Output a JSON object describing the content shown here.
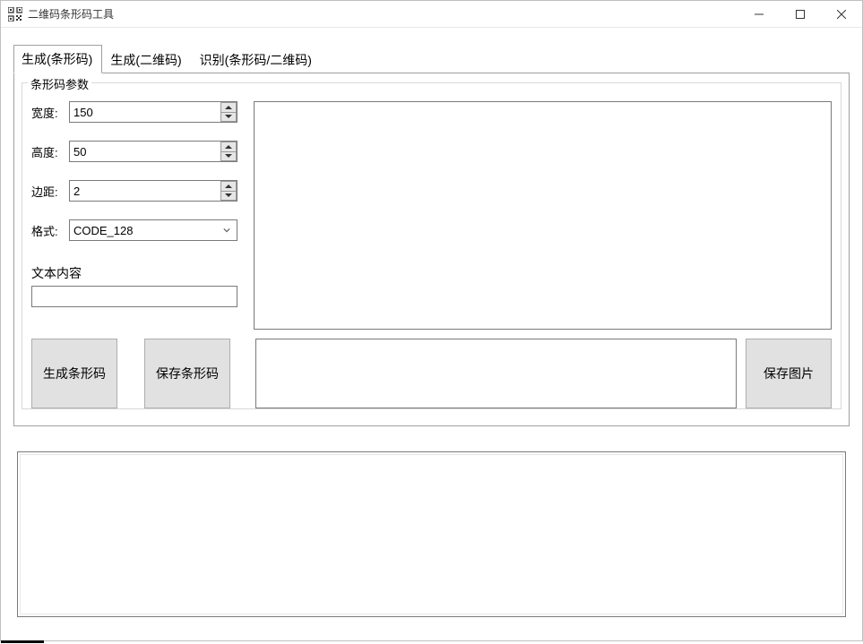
{
  "window": {
    "title": "二维码条形码工具"
  },
  "tabs": [
    {
      "label": "生成(条形码)",
      "active": true
    },
    {
      "label": "生成(二维码)",
      "active": false
    },
    {
      "label": "识别(条形码/二维码)",
      "active": false
    }
  ],
  "groupbox": {
    "legend": "条形码参数"
  },
  "fields": {
    "width": {
      "label": "宽度:",
      "value": "150"
    },
    "height": {
      "label": "高度:",
      "value": "50"
    },
    "margin": {
      "label": "边距:",
      "value": "2"
    },
    "format": {
      "label": "格式:",
      "value": "CODE_128"
    },
    "text": {
      "label": "文本内容",
      "value": ""
    }
  },
  "buttons": {
    "generate_barcode": "生成条形码",
    "save_barcode": "保存条形码",
    "save_image": "保存图片"
  },
  "outputs": {
    "preview": "",
    "result_text": "",
    "log": ""
  }
}
